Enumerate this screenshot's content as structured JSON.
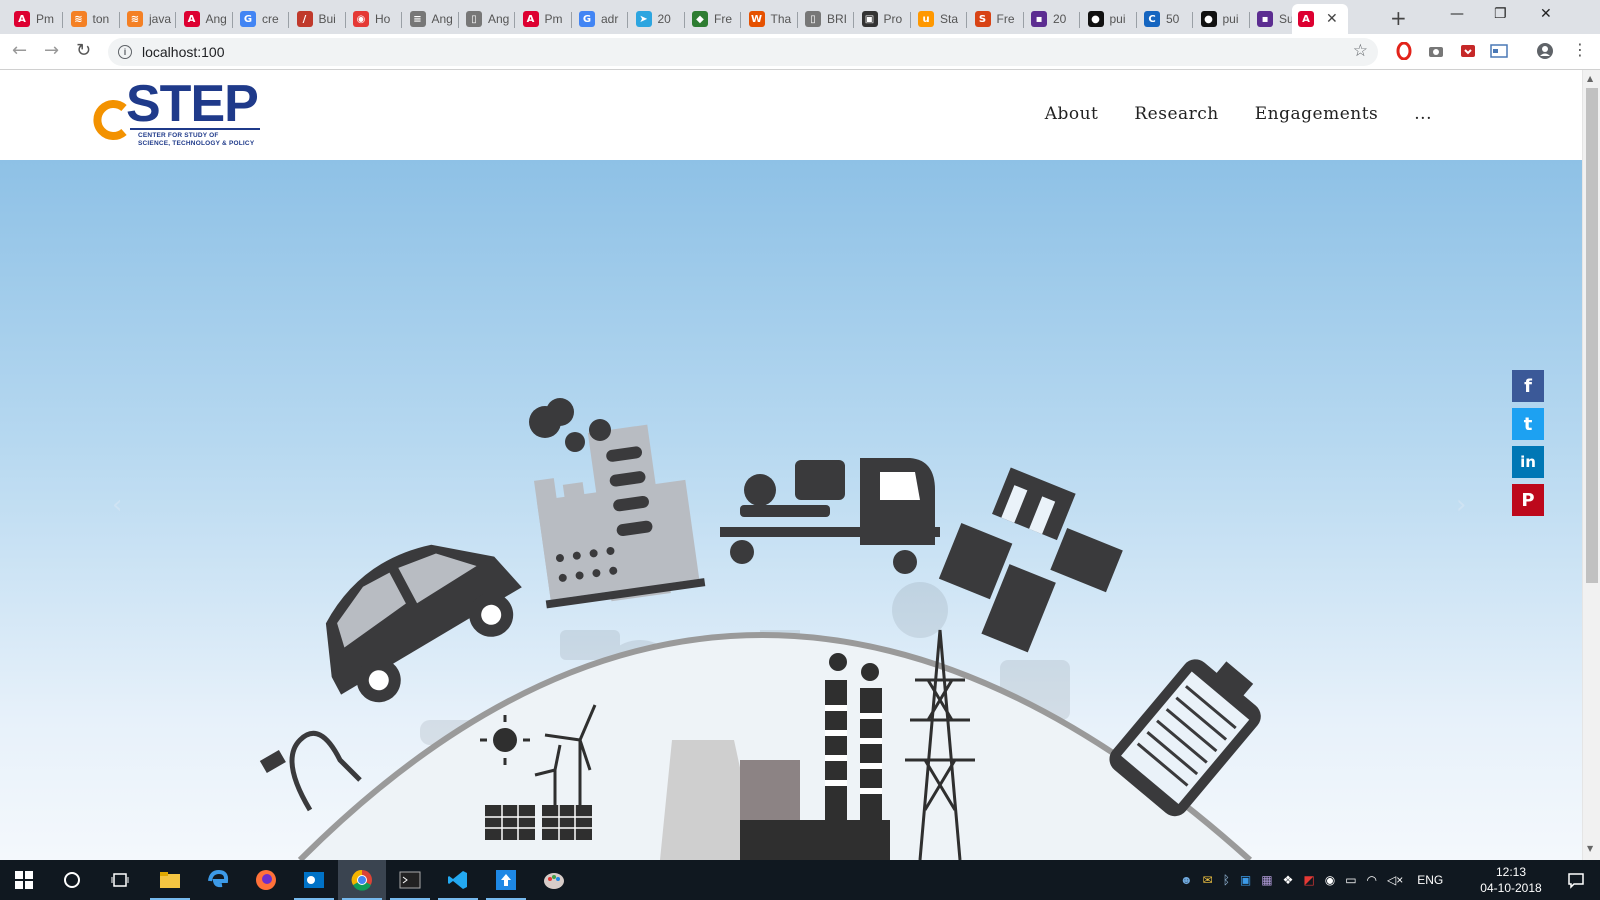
{
  "browser": {
    "tabs": [
      {
        "label": "Pm",
        "icon": "angular-icon",
        "color": "#dd0031"
      },
      {
        "label": "ton",
        "icon": "stackoverflow-icon",
        "color": "#f48024"
      },
      {
        "label": "java",
        "icon": "stackoverflow-icon",
        "color": "#f48024"
      },
      {
        "label": "Ang",
        "icon": "angular-icon",
        "color": "#dd0031"
      },
      {
        "label": "cre",
        "icon": "google-icon",
        "color": "#4285f4"
      },
      {
        "label": "Bui",
        "icon": "slash-icon",
        "color": "#c0392b"
      },
      {
        "label": "Ho",
        "icon": "swirl-icon",
        "color": "#e53935"
      },
      {
        "label": "Ang",
        "icon": "list-icon",
        "color": "#777777"
      },
      {
        "label": "Ang",
        "icon": "document-icon",
        "color": "#777777"
      },
      {
        "label": "Pm",
        "icon": "angular-icon",
        "color": "#dd0031"
      },
      {
        "label": "adr",
        "icon": "google-icon",
        "color": "#4285f4"
      },
      {
        "label": "20",
        "icon": "telegram-icon",
        "color": "#2ca5e0"
      },
      {
        "label": "Fre",
        "icon": "brazil-flag-icon",
        "color": "#2e7d32"
      },
      {
        "label": "Tha",
        "icon": "w-icon",
        "color": "#e65100"
      },
      {
        "label": "BRI",
        "icon": "document-icon",
        "color": "#777777"
      },
      {
        "label": "Pro",
        "icon": "terminal-icon",
        "color": "#333333"
      },
      {
        "label": "Sta",
        "icon": "u-icon",
        "color": "#ff9800"
      },
      {
        "label": "Fre",
        "icon": "s-icon",
        "color": "#d84315"
      },
      {
        "label": "20",
        "icon": "purple-icon",
        "color": "#5c2d91"
      },
      {
        "label": "pui",
        "icon": "github-icon",
        "color": "#111111"
      },
      {
        "label": "50",
        "icon": "c-icon",
        "color": "#1565c0"
      },
      {
        "label": "pui",
        "icon": "github-icon",
        "color": "#111111"
      },
      {
        "label": "Suf",
        "icon": "purple-icon",
        "color": "#5c2d91"
      }
    ],
    "active_tab": {
      "icon": "angular-icon",
      "color": "#dd0031",
      "close": "✕"
    },
    "new_tab": "+",
    "url": "localhost:100"
  },
  "site": {
    "logo": {
      "word": "STEP",
      "line1": "CENTER FOR STUDY OF",
      "line2": "SCIENCE, TECHNOLOGY & POLICY"
    },
    "nav": [
      "About",
      "Research",
      "Engagements",
      "..."
    ]
  },
  "hero": {
    "prev": "‹",
    "next": "›"
  },
  "social": [
    {
      "name": "facebook",
      "glyph": "f",
      "color": "#3b5998"
    },
    {
      "name": "twitter",
      "glyph": "t",
      "color": "#1da1f2"
    },
    {
      "name": "linkedin",
      "glyph": "in",
      "color": "#0077b5"
    },
    {
      "name": "pinterest",
      "glyph": "P",
      "color": "#bd081c"
    }
  ],
  "taskbar": {
    "lang": "ENG",
    "time": "12:13",
    "date": "04-10-2018"
  }
}
